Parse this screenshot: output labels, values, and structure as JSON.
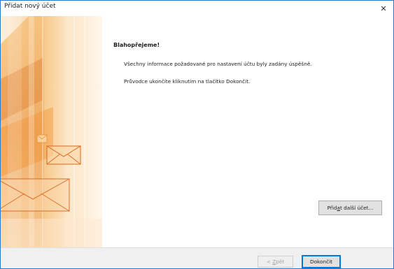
{
  "window": {
    "title": "Přidat nový účet",
    "close_glyph": "✕"
  },
  "content": {
    "heading": "Blahopřejeme!",
    "message1": "Všechny informace požadované pro nastavení účtu byly zadány úspěšně.",
    "message2": "Průvodce ukončíte kliknutím na tlačítko Dokončit.",
    "add_account": {
      "before": "Přid",
      "key": "a",
      "after": "t další účet..."
    }
  },
  "footer": {
    "back": {
      "before": "< ",
      "key": "Z",
      "after": "pět"
    },
    "finish": "Dokončit"
  },
  "colors": {
    "window_border": "#2b79c7",
    "default_button_border": "#0078d7",
    "footer_bg": "#f0f0f0",
    "art_orange": "#f2a33a"
  },
  "icons": {
    "close": "close-icon",
    "art": "envelope-illustration"
  }
}
